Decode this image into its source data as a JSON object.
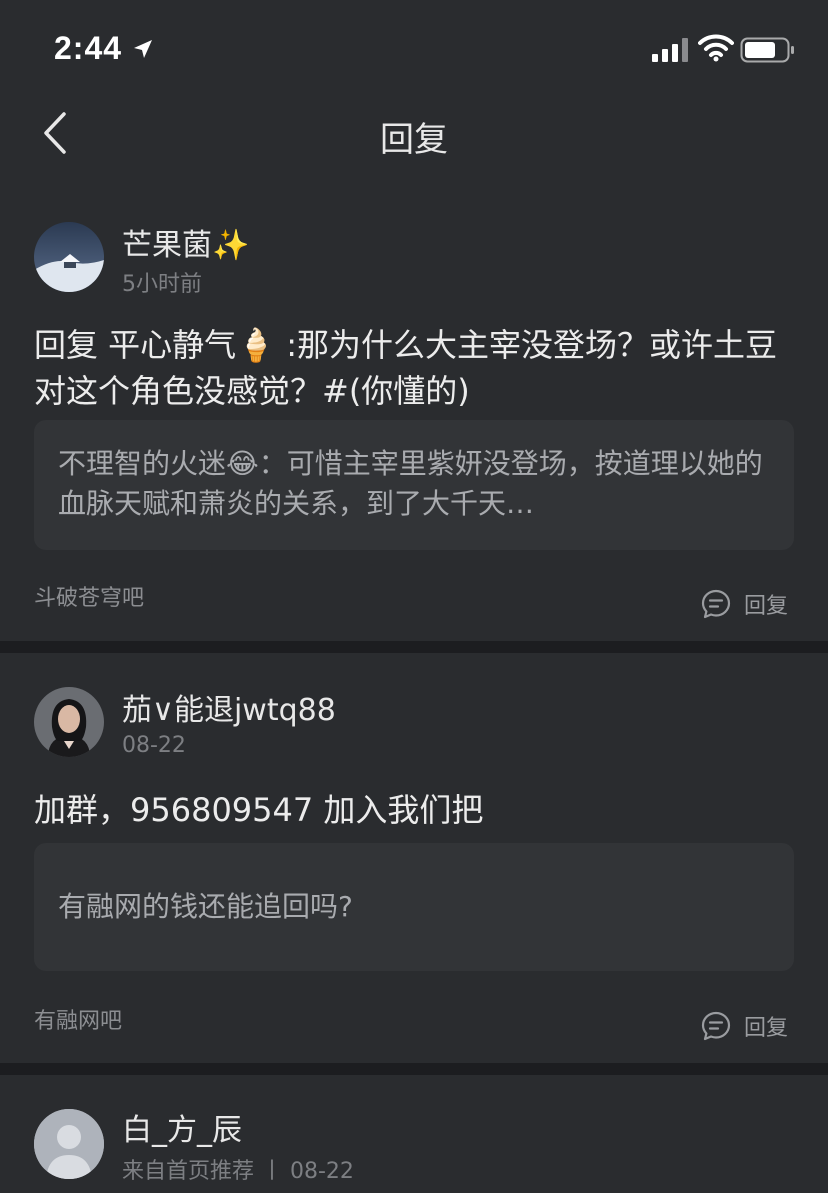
{
  "status_bar": {
    "time": "2:44"
  },
  "nav": {
    "title": "回复"
  },
  "replies": [
    {
      "username": "芒果菌✨",
      "meta": "5小时前",
      "content": "回复 平心静气🍦 :那为什么大主宰没登场？或许土豆对这个角色没感觉？#(你懂的)",
      "quote": "不理智的火迷😂：可惜主宰里紫妍没登场，按道理以她的血脉天赋和萧炎的关系，到了大千天…",
      "forum": "斗破苍穹吧",
      "reply_label": "回复"
    },
    {
      "username": "茄∨能退jwtq88",
      "meta": "08-22",
      "content": "加群，956809547 加入我们把",
      "quote": "有融网的钱还能追回吗?",
      "forum": "有融网吧",
      "reply_label": "回复"
    },
    {
      "username": "白_方_辰",
      "meta": "来自首页推荐 丨 08-22"
    }
  ]
}
